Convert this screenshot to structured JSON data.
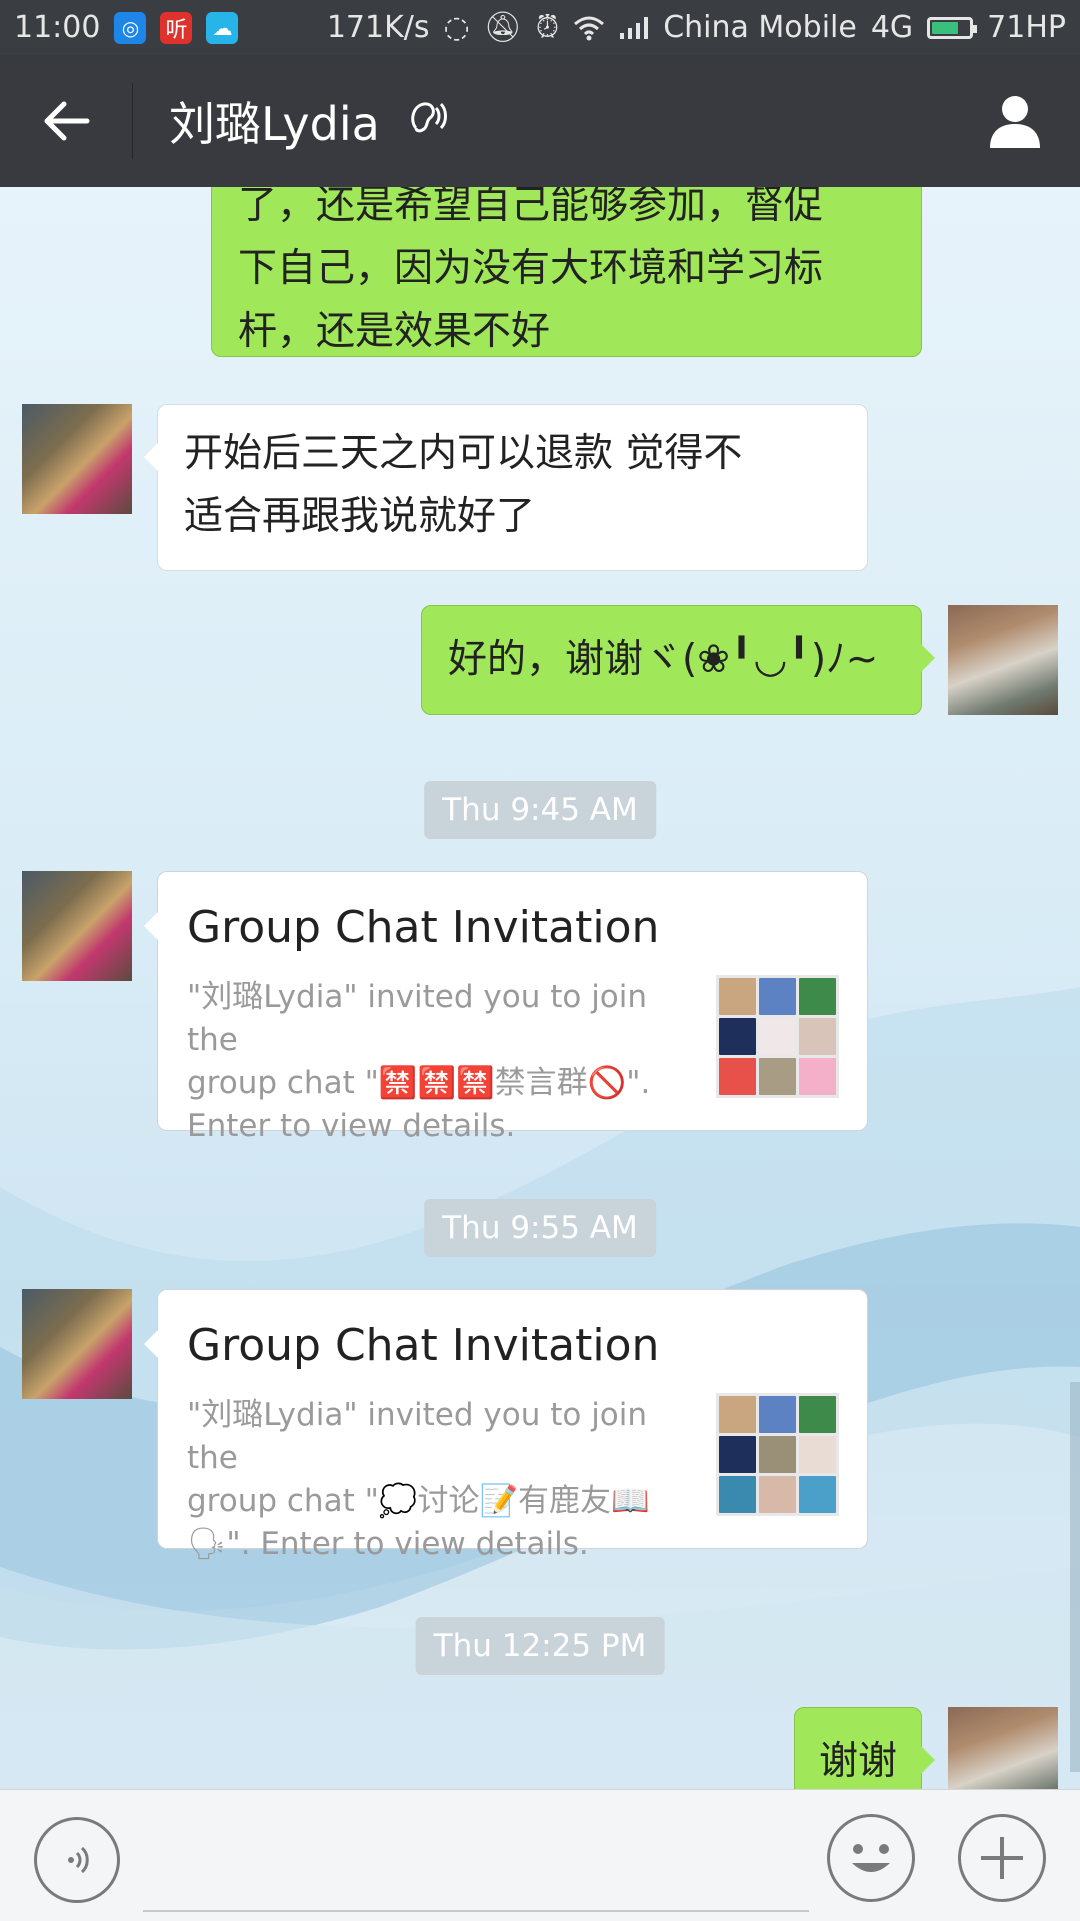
{
  "status_bar": {
    "time": "11:00",
    "speed": "171K/s",
    "carrier": "China Mobile",
    "network": "4G",
    "battery_label": "71HP",
    "battery_level": 0.71,
    "app_icons": [
      "qq-browser-icon",
      "listen-app-icon",
      "cloud-app-icon"
    ],
    "colors": {
      "qq": "#1d86e8",
      "listen": "#e0322d",
      "cloud": "#27b4e8"
    }
  },
  "header": {
    "title": "刘璐Lydia",
    "back_icon": "back-arrow-icon",
    "mode_icon": "earpiece-mode-icon",
    "profile_icon": "profile-icon"
  },
  "messages": [
    {
      "id": "m1",
      "side": "right",
      "type": "text",
      "text": "了，还是希望自己能够参加，督促下自己，因为没有大环境和学习标杆，还是效果不好",
      "lines": [
        "了，还是希望自己能够参加，督促",
        "下自己，因为没有大环境和学习标",
        "杆，还是效果不好"
      ]
    },
    {
      "id": "m2",
      "side": "left",
      "type": "text",
      "lines": [
        "开始后三天之内可以退款 觉得不",
        "适合再跟我说就好了"
      ]
    },
    {
      "id": "m3",
      "side": "right",
      "type": "text",
      "text": "好的，谢谢ヾ(❀╹◡╹)ﾉ~"
    },
    {
      "id": "t1",
      "type": "timestamp",
      "text": "Thu 9:45 AM"
    },
    {
      "id": "m4",
      "side": "left",
      "type": "card",
      "title": "Group Chat Invitation",
      "lines": [
        "\"刘璐Lydia\" invited you to join the",
        "group chat \"🈲🈲🈲禁言群🚫\".",
        "Enter to view details."
      ]
    },
    {
      "id": "t2",
      "type": "timestamp",
      "text": "Thu 9:55 AM"
    },
    {
      "id": "m5",
      "side": "left",
      "type": "card",
      "title": "Group Chat Invitation",
      "lines": [
        "\"刘璐Lydia\" invited you to join the",
        "group chat \"💭讨论📝有鹿友📖",
        "🗣\". Enter to view details."
      ]
    },
    {
      "id": "t3",
      "type": "timestamp",
      "text": "Thu 12:25 PM"
    },
    {
      "id": "m6",
      "side": "right",
      "type": "text",
      "text": "谢谢"
    }
  ],
  "input_bar": {
    "voice_icon": "voice-input-icon",
    "emoji_icon": "emoji-icon",
    "more_icon": "plus-icon",
    "placeholder": ""
  },
  "colors": {
    "outgoing_bubble": "#a0e75a",
    "incoming_bubble": "#ffffff",
    "header_bg": "#393a3f",
    "status_bg": "#3a3d41"
  }
}
